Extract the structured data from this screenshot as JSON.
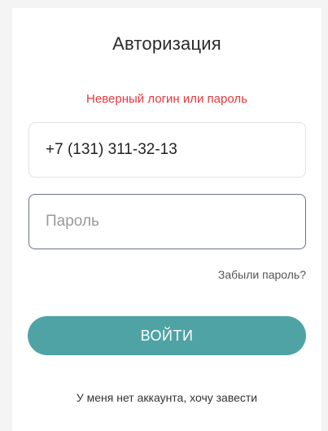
{
  "auth": {
    "title": "Авторизация",
    "error_message": "Неверный логин или пароль",
    "phone_value": "+7 (131) 311-32-13",
    "password_placeholder": "Пароль",
    "forgot_password_label": "Забыли пароль?",
    "login_button_label": "ВОЙТИ",
    "register_link_label": "У меня нет аккаунта, хочу завести"
  },
  "colors": {
    "error": "#f0353b",
    "accent": "#4fa3a5",
    "active_border": "#6b7583"
  }
}
